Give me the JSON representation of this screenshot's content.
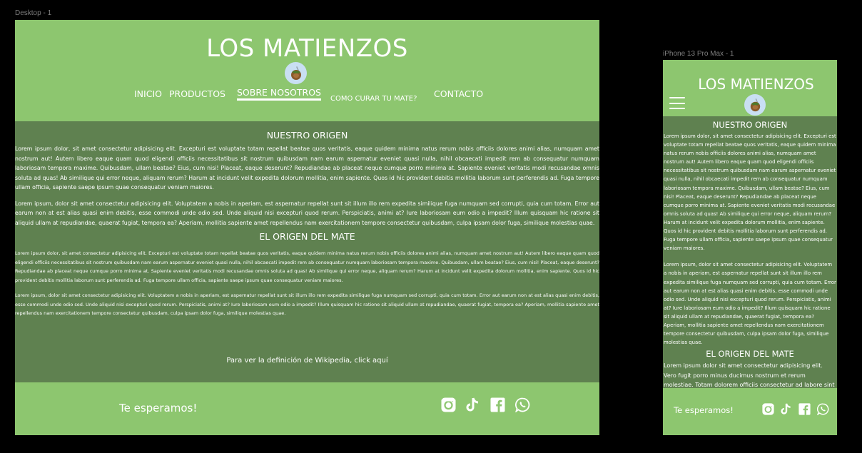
{
  "frames": {
    "desktop_label": "Desktop - 1",
    "mobile_label": "iPhone 13 Pro Max - 1"
  },
  "site": {
    "title": "LOS MATIENZOS",
    "nav": [
      "INICIO",
      "PRODUCTOS",
      "SOBRE NOSOTROS",
      "COMO CURAR TU MATE?",
      "CONTACTO"
    ],
    "active_nav": "SOBRE NOSOTROS"
  },
  "desktop": {
    "section1_title": "NUESTRO ORIGEN",
    "section1_p1": "Lorem ipsum dolor, sit amet consectetur adipisicing elit. Excepturi est voluptate totam repellat beatae quos veritatis, eaque quidem minima natus rerum nobis officiis dolores animi alias, numquam amet nostrum aut! Autem libero eaque quam quod eligendi officiis necessitatibus sit nostrum quibusdam nam earum aspernatur eveniet quasi nulla, nihil obcaecati impedit rem ab consequatur numquam laboriosam tempora maxime. Quibusdam, ullam beatae? Eius, cum nisi! Placeat, eaque deserunt? Repudiandae ab placeat neque cumque porro minima at. Sapiente eveniet veritatis modi recusandae omnis soluta ad quas! Ab similique qui error neque, aliquam rerum? Harum at incidunt velit expedita dolorum mollitia, enim sapiente. Quos id hic provident debitis mollitia laborum sunt perferendis ad. Fuga tempore ullam officia, sapiente saepe ipsum quae consequatur veniam maiores.",
    "section1_p2": "Lorem ipsum, dolor sit amet consectetur adipisicing elit. Voluptatem a nobis in aperiam, est aspernatur repellat sunt sit illum illo rem expedita similique fuga numquam sed corrupti, quia cum totam. Error aut earum non at est alias quasi enim debitis, esse commodi unde odio sed. Unde aliquid nisi excepturi quod rerum. Perspiciatis, animi at? Iure laboriosam eum odio a impedit? Illum quisquam hic ratione sit aliquid ullam at repudiandae, quaerat fugiat, tempora ea? Aperiam, mollitia sapiente amet repellendus nam exercitationem tempore consectetur quibusdam, culpa ipsam dolor fuga, similique molestias quae.",
    "section2_title": "EL ORIGEN DEL MATE",
    "section2_p1": "Lorem ipsum dolor, sit amet consectetur adipisicing elit. Excepturi est voluptate totam repellat beatae quos veritatis, eaque quidem minima natus rerum nobis officiis dolores animi alias, numquam amet nostrum aut! Autem libero eaque quam quod eligendi officiis necessitatibus sit nostrum quibusdam nam earum aspernatur eveniet quasi nulla, nihil obcaecati impedit rem ab consequatur numquam laboriosam tempora maxime. Quibusdam, ullam beatae? Eius, cum nisi! Placeat, eaque deserunt? Repudiandae ab placeat neque cumque porro minima at. Sapiente eveniet veritatis modi recusandae omnis soluta ad quas! Ab similique qui error neque, aliquam rerum? Harum at incidunt velit expedita dolorum mollitia, enim sapiente. Quos id hic provident debitis mollitia laborum sunt perferendis ad. Fuga tempore ullam officia, sapiente saepe ipsum quae consequatur veniam maiores.",
    "section2_p2": "Lorem ipsum, dolor sit amet consectetur adipisicing elit. Voluptatem a nobis in aperiam, est aspernatur repellat sunt sit illum illo rem expedita similique fuga numquam sed corrupti, quia cum totam. Error aut earum non at est alias quasi enim debitis, esse commodi unde odio sed. Unde aliquid nisi excepturi quod rerum. Perspiciatis, animi at? Iure laboriosam eum odio a impedit? Illum quisquam hic ratione sit aliquid ullam at repudiandae, quaerat fugiat, tempora ea? Aperiam, mollitia sapiente amet repellendus nam exercitationem tempore consectetur quibusdam, culpa ipsam dolor fuga, similique molestias quae.",
    "wiki_text": "Para ver la definición de Wikipedia, click aquí"
  },
  "mobile": {
    "section1_title": "NUESTRO ORIGEN",
    "section1_p1": "Lorem ipsum dolor, sit amet consectetur adipisicing elit. Excepturi est voluptate totam repellat beatae quos veritatis, eaque quidem minima natus rerum nobis officiis dolores animi alias, numquam amet nostrum aut! Autem libero eaque quam quod eligendi officiis necessitatibus sit nostrum quibusdam nam earum aspernatur eveniet quasi nulla, nihil obcaecati impedit rem ab consequatur numquam laboriosam tempora maxime. Quibusdam, ullam beatae? Eius, cum nisi! Placeat, eaque deserunt? Repudiandae ab placeat neque cumque porro minima at. Sapiente eveniet veritatis modi recusandae omnis soluta ad quas! Ab similique qui error neque, aliquam rerum? Harum at incidunt velit expedita dolorum mollitia, enim sapiente. Quos id hic provident debitis mollitia laborum sunt perferendis ad. Fuga tempore ullam officia, sapiente saepe ipsum quae consequatur veniam maiores.",
    "section1_p2": "Lorem ipsum, dolor sit amet consectetur adipisicing elit. Voluptatem a nobis in aperiam, est aspernatur repellat sunt sit illum illo rem expedita similique fuga numquam sed corrupti, quia cum totam. Error aut earum non at est alias quasi enim debitis, esse commodi unde odio sed. Unde aliquid nisi excepturi quod rerum. Perspiciatis, animi at? Iure laboriosam eum odio a impedit? Illum quisquam hic ratione sit aliquid ullam at repudiandae, quaerat fugiat, tempora ea? Aperiam, mollitia sapiente amet repellendus nam exercitationem tempore consectetur quibusdam, culpa ipsam dolor fuga, similique molestias quae.",
    "section2_title": "EL ORIGEN DEL MATE",
    "section2_p1": "Lorem ipsum dolor sit amet consectetur adipisicing elit. Vero fugit porro minus ducimus nostrum et rerum molestiae. Totam dolorem officiis consectetur ad labore sint"
  },
  "footer": {
    "text": "Te esperamos!",
    "social": [
      "instagram-icon",
      "tiktok-icon",
      "facebook-icon",
      "whatsapp-icon"
    ]
  },
  "colors": {
    "header_green": "#8dc66f",
    "content_green": "#5f8150",
    "text": "#ffffff",
    "canvas": "#000000"
  }
}
